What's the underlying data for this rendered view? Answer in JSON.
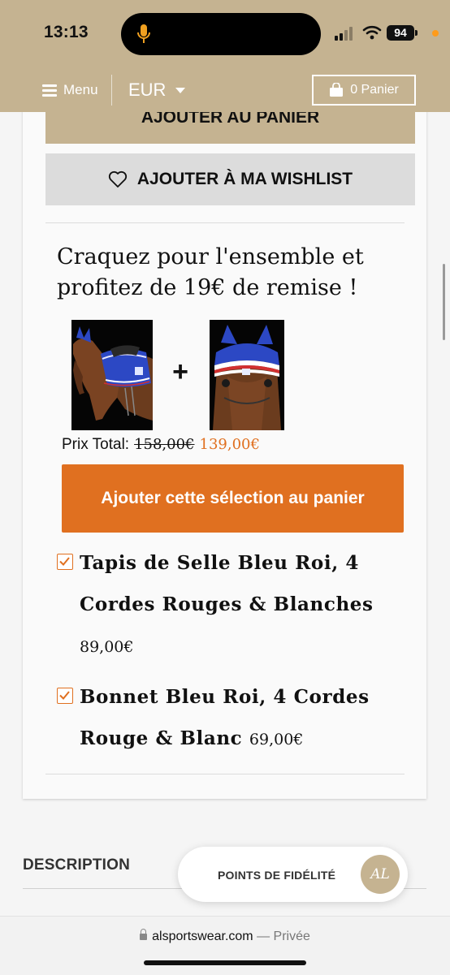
{
  "status_bar": {
    "time": "13:13",
    "battery": "94"
  },
  "header": {
    "menu_label": "Menu",
    "currency": "EUR",
    "cart_label": "0 Panier"
  },
  "product": {
    "add_to_cart_label": "AJOUTER AU PANIER",
    "wishlist_label": "AJOUTER À MA WISHLIST"
  },
  "bundle": {
    "title": "Craquez pour l'ensemble et profitez de 19€ de remise !",
    "plus": "+",
    "total_label": "Prix Total:",
    "old_total": "158,00€",
    "new_total": "139,00€",
    "add_selection_label": "Ajouter cette sélection au panier",
    "items": [
      {
        "name": "Tapis de Selle Bleu Roi, 4 Cordes Rouges & Blanches",
        "price": "89,00€",
        "checked": true
      },
      {
        "name": "Bonnet Bleu Roi, 4 Cordes Rouge & Blanc",
        "price": "69,00€",
        "checked": true
      }
    ]
  },
  "description": {
    "label": "DESCRIPTION"
  },
  "loyalty": {
    "label": "POINTS DE FIDÉLITÉ",
    "logo_text": "AL"
  },
  "browser": {
    "domain": "alsportswear.com",
    "separator": " — ",
    "mode": "Privée"
  },
  "colors": {
    "gold": "#c5b391",
    "orange": "#e07020",
    "royal_blue": "#1f3fb0"
  }
}
